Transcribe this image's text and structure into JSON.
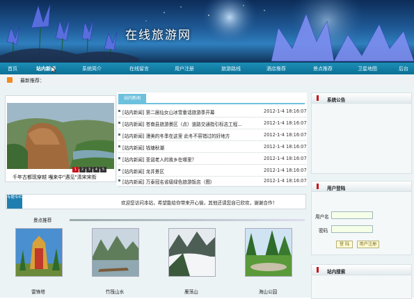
{
  "site": {
    "title": "在线旅游网"
  },
  "nav": [
    {
      "label": "首页"
    },
    {
      "label": "站内新闻"
    },
    {
      "label": "系统简介"
    },
    {
      "label": "在线留言"
    },
    {
      "label": "用户注册"
    },
    {
      "label": "旅游路线"
    },
    {
      "label": "酒店推荐"
    },
    {
      "label": "景点推荐"
    },
    {
      "label": "卫星地图"
    },
    {
      "label": "后台"
    }
  ],
  "recommend": {
    "label": "最新推荐："
  },
  "slideshow": {
    "caption": "千年古都现穿越 嘎来中\"遇见\"清宋宋街",
    "pager": [
      "1",
      "2",
      "3",
      "4",
      "5"
    ],
    "active_page": "1"
  },
  "news": {
    "tab": "站内新闻",
    "rows": [
      {
        "title": "[站内新闻] 第二届仙女山冰雪童话旅游季开幕",
        "date": "2012-1-4 18:16:07"
      },
      {
        "title": "[站内新闻] 苍南县旅游景区（点）道路交通指引标志工程...",
        "date": "2012-1-4 18:16:07"
      },
      {
        "title": "[站内新闻] 漫美的冬季在这里 此冬不容错过的好地方",
        "date": "2012-1-4 18:16:07"
      },
      {
        "title": "[站内新闻] 钱塘秋潮",
        "date": "2012-1-4 18:16:07"
      },
      {
        "title": "[站内新闻] 圣诞老人的故乡在哪里？",
        "date": "2012-1-4 18:16:07"
      },
      {
        "title": "[站内新闻] 龙井景区",
        "date": "2012-1-4 18:16:07"
      },
      {
        "title": "[站内新闻] 万泰冠名省级绿色旅游饭店（图）",
        "date": "2012-1-4 18:16:07"
      }
    ]
  },
  "welcome": {
    "badge": "专题专栏",
    "message": "欢迎您访问本站，希望能给你带来开心愉，其他还请您自已欣欢，谢谢合作！"
  },
  "scenic": {
    "label": "景点推荐",
    "items": [
      {
        "name": "雷锋塔"
      },
      {
        "name": "竹筏山水"
      },
      {
        "name": "雁荡山"
      },
      {
        "name": "海山公园"
      }
    ]
  },
  "sidebar": {
    "announcement": {
      "title": "系统公告"
    },
    "login": {
      "title": "用户登陆",
      "username_label": "用户名",
      "password_label": "密码",
      "login_button": "登 陆",
      "register_button": "用户注册"
    },
    "search": {
      "title": "站内搜索"
    }
  }
}
